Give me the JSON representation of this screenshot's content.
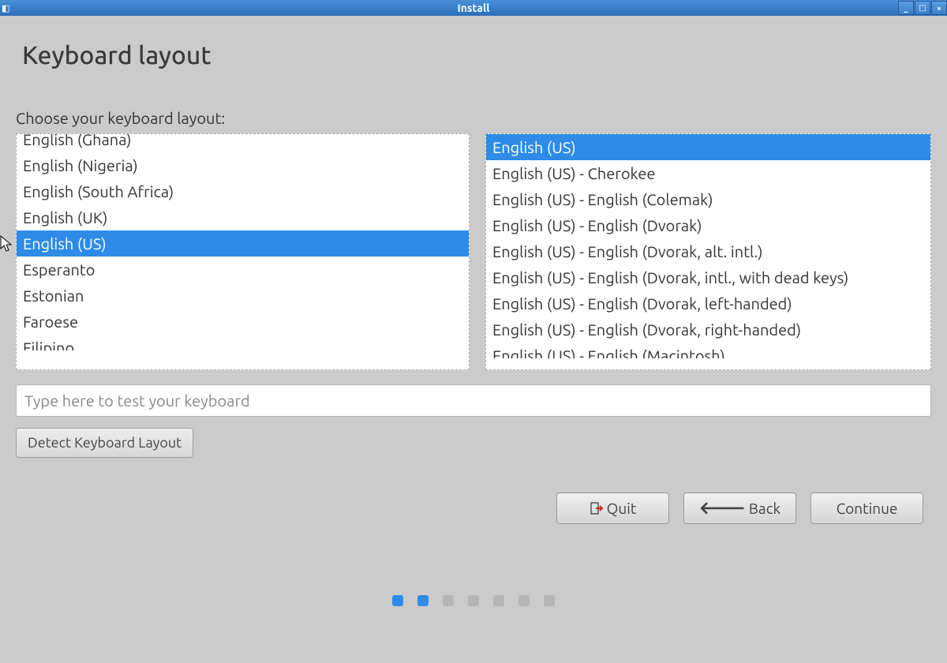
{
  "window": {
    "title": "Install"
  },
  "page": {
    "title": "Keyboard layout",
    "choose_label": "Choose your keyboard layout:"
  },
  "layouts": {
    "selected_index": 4,
    "items": [
      "English (Ghana)",
      "English (Nigeria)",
      "English (South Africa)",
      "English (UK)",
      "English (US)",
      "Esperanto",
      "Estonian",
      "Faroese",
      "Filipino"
    ]
  },
  "variants": {
    "selected_index": 0,
    "items": [
      "English (US)",
      "English (US) - Cherokee",
      "English (US) - English (Colemak)",
      "English (US) - English (Dvorak)",
      "English (US) - English (Dvorak, alt. intl.)",
      "English (US) - English (Dvorak, intl., with dead keys)",
      "English (US) - English (Dvorak, left-handed)",
      "English (US) - English (Dvorak, right-handed)",
      "English (US) - English (Macintosh)"
    ]
  },
  "test_input": {
    "placeholder": "Type here to test your keyboard",
    "value": ""
  },
  "buttons": {
    "detect": "Detect Keyboard Layout",
    "quit": "Quit",
    "back": "Back",
    "continue": "Continue"
  },
  "progress": {
    "total": 7,
    "active": [
      0,
      1
    ]
  }
}
